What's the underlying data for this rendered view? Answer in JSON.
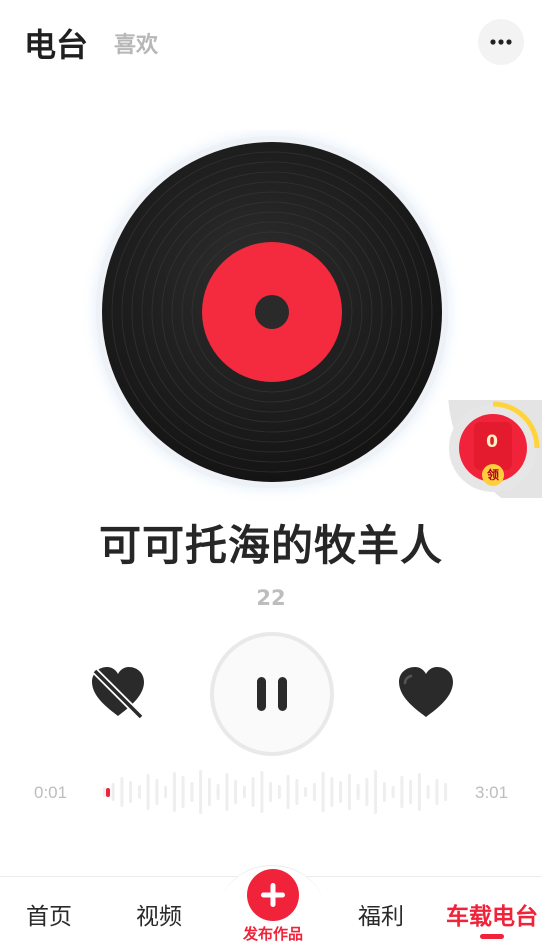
{
  "header": {
    "tab_active": "电台",
    "tab_inactive": "喜欢"
  },
  "widget": {
    "count": "0",
    "badge": "领"
  },
  "song": {
    "title": "可可托海的牧羊人",
    "count": "22"
  },
  "player": {
    "current_time": "0:01",
    "total_time": "3:01",
    "state": "playing",
    "progress": 0.006
  },
  "tabbar": {
    "home": "首页",
    "video": "视频",
    "publish": "发布作品",
    "welfare": "福利",
    "car_radio": "车载电台",
    "active": "车载电台"
  },
  "colors": {
    "accent": "#f0233b",
    "disc_label": "#f42b3e",
    "disc_vinyl": "#1e1e1e",
    "control_icon": "#2a2a2a"
  },
  "icons": {
    "more": "ellipsis-icon",
    "dislike": "heart-crossed-icon",
    "pause": "pause-icon",
    "like": "heart-icon",
    "publish": "plus-icon"
  }
}
